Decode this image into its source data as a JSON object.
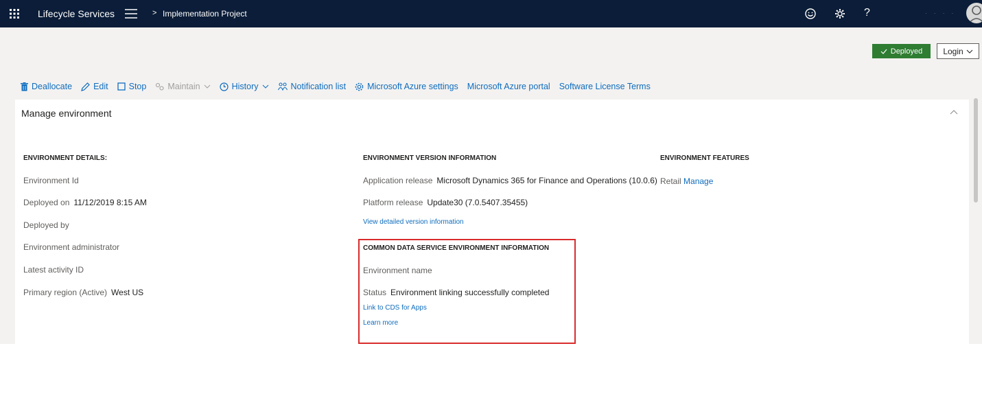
{
  "topbar": {
    "app_name": "Lifecycle Services",
    "breadcrumb_sep": ">",
    "breadcrumb": "Implementation Project",
    "help": "?",
    "user_dots": "· · · ·"
  },
  "status": {
    "label": "Deployed",
    "color": "#2e7d32"
  },
  "login": {
    "label": "Login"
  },
  "toolbar": {
    "deallocate": "Deallocate",
    "edit": "Edit",
    "stop": "Stop",
    "maintain": "Maintain",
    "history": "History",
    "notification_list": "Notification list",
    "azure_settings": "Microsoft Azure settings",
    "azure_portal": "Microsoft Azure portal",
    "license_terms": "Software License Terms"
  },
  "panel": {
    "title": "Manage environment"
  },
  "details": {
    "heading": "ENVIRONMENT DETAILS:",
    "environment_id_label": "Environment Id",
    "deployed_on_label": "Deployed on",
    "deployed_on_value": "11/12/2019 8:15 AM",
    "deployed_by_label": "Deployed by",
    "admin_label": "Environment administrator",
    "activity_label": "Latest activity ID",
    "region_label": "Primary region (Active)",
    "region_value": "West US"
  },
  "version": {
    "heading": "ENVIRONMENT VERSION INFORMATION",
    "app_release_label": "Application release",
    "app_release_value": "Microsoft Dynamics 365 for Finance and Operations (10.0.6)",
    "platform_release_label": "Platform release",
    "platform_release_value": "Update30 (7.0.5407.35455)",
    "detail_link": "View detailed version information"
  },
  "cds": {
    "heading": "COMMON DATA SERVICE ENVIRONMENT INFORMATION",
    "env_name_label": "Environment name",
    "status_label": "Status",
    "status_value": "Environment linking successfully completed",
    "link_cds": "Link to CDS for Apps",
    "learn_more": "Learn more"
  },
  "features": {
    "heading": "ENVIRONMENT FEATURES",
    "retail_label": "Retail",
    "manage_link": "Manage"
  }
}
